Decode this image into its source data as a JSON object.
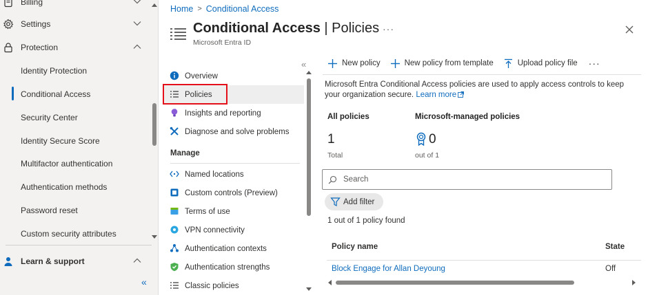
{
  "left_nav": {
    "items": [
      {
        "label": "Billing",
        "icon": "billing-icon",
        "expandable": true,
        "expanded": false
      },
      {
        "label": "Settings",
        "icon": "gear-icon",
        "expandable": true,
        "expanded": false
      },
      {
        "label": "Protection",
        "icon": "lock-icon",
        "expandable": true,
        "expanded": true
      }
    ],
    "protection_children": [
      {
        "label": "Identity Protection"
      },
      {
        "label": "Conditional Access",
        "active": true
      },
      {
        "label": "Security Center"
      },
      {
        "label": "Identity Secure Score"
      },
      {
        "label": "Multifactor authentication"
      },
      {
        "label": "Authentication methods"
      },
      {
        "label": "Password reset"
      },
      {
        "label": "Custom security attributes"
      }
    ],
    "learn_support": {
      "label": "Learn & support",
      "icon": "person-support-icon"
    },
    "collapse_glyph": "«"
  },
  "breadcrumb": {
    "home": "Home",
    "separator": ">",
    "current": "Conditional Access"
  },
  "header": {
    "title_main": "Conditional Access",
    "title_sep": " | ",
    "title_page": "Policies",
    "subtitle": "Microsoft Entra ID",
    "more": "···"
  },
  "blade_menu": {
    "collapse_glyph": "«",
    "items": [
      {
        "label": "Overview",
        "icon": "info-icon"
      },
      {
        "label": "Policies",
        "icon": "list-icon",
        "selected": true
      },
      {
        "label": "Insights and reporting",
        "icon": "lightbulb-icon"
      },
      {
        "label": "Diagnose and solve problems",
        "icon": "wrench-icon"
      }
    ],
    "section_manage": "Manage",
    "manage_items": [
      {
        "label": "Named locations",
        "icon": "location-arrows-icon"
      },
      {
        "label": "Custom controls (Preview)",
        "icon": "custom-controls-icon"
      },
      {
        "label": "Terms of use",
        "icon": "terms-icon"
      },
      {
        "label": "VPN connectivity",
        "icon": "vpn-gear-icon"
      },
      {
        "label": "Authentication contexts",
        "icon": "auth-context-icon"
      },
      {
        "label": "Authentication strengths",
        "icon": "shield-check-icon"
      },
      {
        "label": "Classic policies",
        "icon": "list-icon"
      }
    ]
  },
  "toolbar": {
    "new_policy": "New policy",
    "new_from_template": "New policy from template",
    "upload": "Upload policy file",
    "more": "···"
  },
  "description": {
    "text": "Microsoft Entra Conditional Access policies are used to apply access controls to keep your organization secure. ",
    "link": "Learn more"
  },
  "stats": {
    "all_label": "All policies",
    "all_value": "1",
    "all_sub": "Total",
    "managed_label": "Microsoft-managed policies",
    "managed_value": "0",
    "managed_sub": "out of 1"
  },
  "search": {
    "placeholder": "Search",
    "value": ""
  },
  "filter": {
    "label": "Add filter"
  },
  "results": {
    "count_text": "1 out of 1 policy found"
  },
  "table": {
    "columns": [
      "Policy name",
      "State"
    ],
    "rows": [
      {
        "name": "Block Engage for Allan Deyoung",
        "state": "Off"
      }
    ]
  },
  "colors": {
    "accent": "#0f6cbd",
    "highlight_border": "#e3101a",
    "nav_bg": "#f3f2f1"
  }
}
